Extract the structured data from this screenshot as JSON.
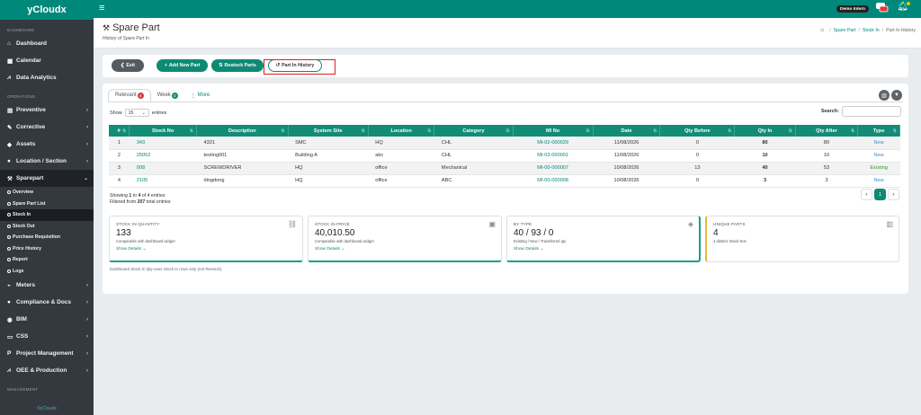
{
  "app": {
    "brand": "yCloudx",
    "env_badge": "Demo Intern"
  },
  "sidebar": {
    "sections": {
      "dashboard": "DASHBOARD",
      "operations": "OPERATIONS",
      "management": "MANAGEMENT"
    },
    "top_items": [
      {
        "label": "Dashboard",
        "icon": "home-icon"
      },
      {
        "label": "Calendar",
        "icon": "calendar-icon"
      },
      {
        "label": "Data Analytics",
        "icon": "chart-icon"
      }
    ],
    "ops_items": [
      {
        "label": "Preventive",
        "icon": "calendar-check-icon"
      },
      {
        "label": "Corrective",
        "icon": "wrench-icon"
      },
      {
        "label": "Assets",
        "icon": "tag-icon"
      },
      {
        "label": "Location / Section",
        "icon": "location-pin-icon"
      },
      {
        "label": "Sparepart",
        "icon": "sparepart-icon"
      }
    ],
    "sparepart_sub": [
      "Overview",
      "Spare Part List",
      "Stock In",
      "Stock Out",
      "Purchase Requisition",
      "Price History",
      "Report",
      "Logs"
    ],
    "bottom_items": [
      {
        "label": "Meters",
        "icon": "meter-icon"
      },
      {
        "label": "Compliance & Docs",
        "icon": "doc-icon"
      },
      {
        "label": "BIM",
        "icon": "cube-icon"
      },
      {
        "label": "CSS",
        "icon": "monitor-icon"
      },
      {
        "label": "Project Management",
        "icon": "project-icon"
      },
      {
        "label": "OEE & Production",
        "icon": "line-chart-icon"
      }
    ],
    "footer": "©yCloudx"
  },
  "header": {
    "title": "Spare Part",
    "subtitle": "History of Spare Part In",
    "breadcrumb": [
      "Spare Part",
      "Stock In",
      "Part In History"
    ]
  },
  "toolbar": {
    "exit": "Exit",
    "add": "Add New Part",
    "restock": "Restock Parts",
    "history": "Part In History"
  },
  "tabs": {
    "relevant": "Relevant",
    "relevant_count": "4",
    "week": "Week",
    "week_count": "0",
    "more": "More"
  },
  "list": {
    "show_prefix": "Show",
    "show_value": "15",
    "show_suffix": "entries",
    "search_label": "Search:",
    "columns": [
      "#",
      "Stock No",
      "Description",
      "System Site",
      "Location",
      "Category",
      "MI No",
      "Date",
      "Qty Before",
      "Qty In",
      "Qty After",
      "Type"
    ],
    "rows": [
      {
        "n": "1",
        "stock": "343",
        "desc": "4321",
        "site": "SMC",
        "loc": "HQ",
        "cat": "CHL",
        "mi": "MI-02-000029",
        "date": "11/08/2026",
        "before": "0",
        "qtyin": "80",
        "after": "80",
        "type": "New"
      },
      {
        "n": "2",
        "stock": "25052",
        "desc": "testing001",
        "site": "Building A",
        "loc": "abc",
        "cat": "CHL",
        "mi": "MI-03-000001",
        "date": "11/08/2026",
        "before": "0",
        "qtyin": "10",
        "after": "10",
        "type": "New"
      },
      {
        "n": "3",
        "stock": "008",
        "desc": "SCREWDRIVER",
        "site": "HQ",
        "loc": "office",
        "cat": "Mechanical",
        "mi": "MI-00-000007",
        "date": "10/08/2026",
        "before": "13",
        "qtyin": "40",
        "after": "53",
        "type": "Existing"
      },
      {
        "n": "4",
        "stock": "2105",
        "desc": "dingdong",
        "site": "HQ",
        "loc": "office",
        "cat": "ABC",
        "mi": "MI-00-000008",
        "date": "10/08/2026",
        "before": "0",
        "qtyin": "3",
        "after": "3",
        "type": "New"
      }
    ],
    "info_a": "Showing",
    "info_from": "1",
    "info_to": "to",
    "info_end": "4",
    "info_of": "of 4 entries",
    "info_filtered": "Filtered from",
    "info_total": "207",
    "info_total_suffix": "total entries",
    "page": "1"
  },
  "cards": [
    {
      "title": "STOCK IN QUANTITY",
      "value": "133",
      "desc": "Comparable with dashboard widget",
      "link": "Show Details",
      "icon": "boxes-icon"
    },
    {
      "title": "STOCK IN PRICE",
      "value": "40,010.50",
      "desc": "Comparable with dashboard widget",
      "link": "Show Details",
      "icon": "money-icon"
    },
    {
      "title": "BY TYPE",
      "value": "40 / 93 / 0",
      "desc": "Existing / New / Transferred qty",
      "link": "Show Details",
      "icon": "tags-icon"
    },
    {
      "title": "UNIQUE PARTS",
      "value": "4",
      "desc": "4 distinct Stock Nos",
      "link": "",
      "icon": "barcode-icon"
    }
  ],
  "note": "Dashboard Stock In Qty uses Stock In rows only (not Restock).",
  "colors": {
    "primary": "#00897b",
    "table_header": "#128c77",
    "sidebar": "#34393f",
    "highlight": "#e0201c"
  }
}
